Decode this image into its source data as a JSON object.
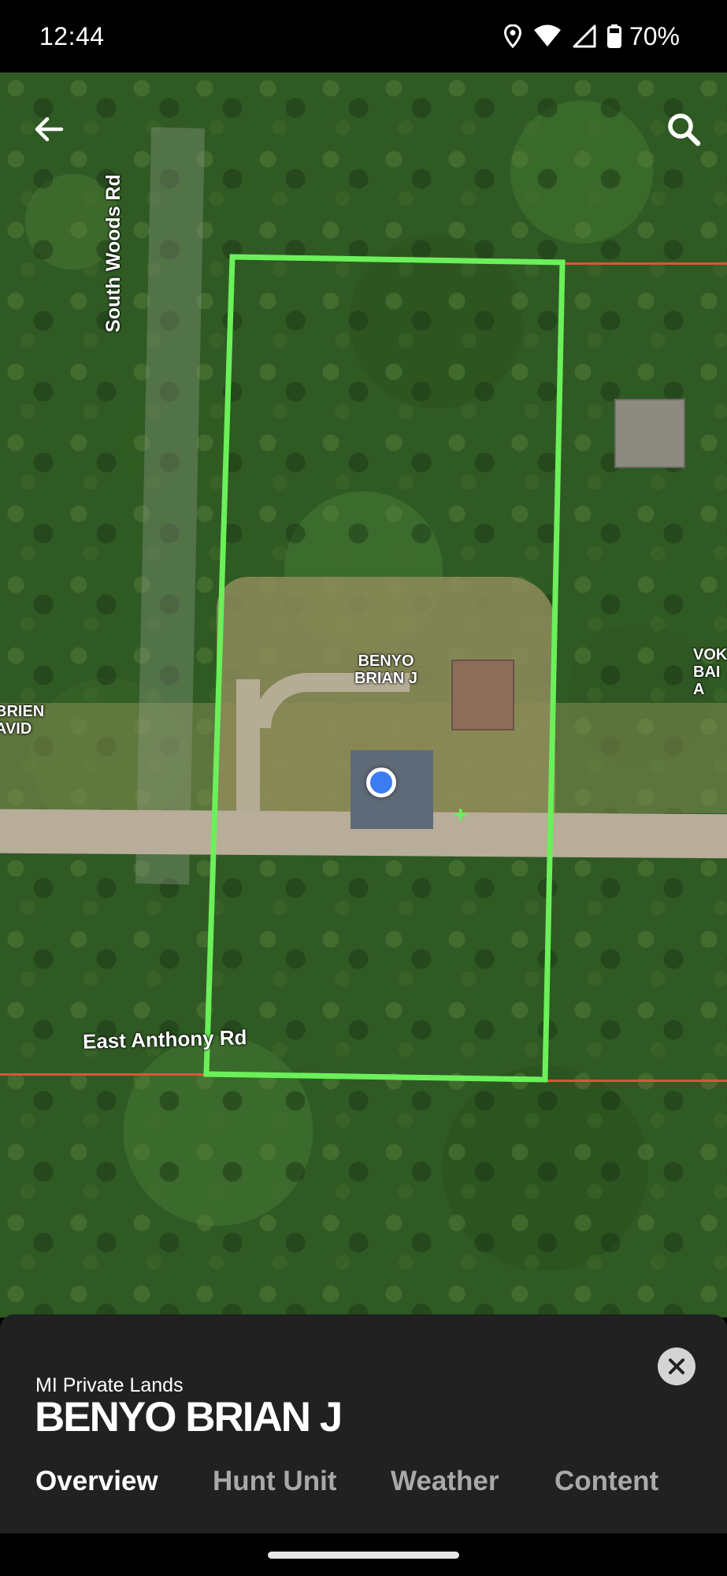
{
  "status_bar": {
    "time": "12:44",
    "battery": "70%",
    "icons": [
      "location-icon",
      "wifi-icon",
      "cell-signal-icon",
      "battery-icon"
    ]
  },
  "map": {
    "roads": {
      "north_south": "South Woods Rd",
      "east_west": "East Anthony Rd"
    },
    "owner_labels": {
      "parcel": "BENYO\nBRIAN J",
      "left_partial": "BRIEN\nAVID",
      "right_partial": "VOK\nBAI\nA"
    },
    "parcel_outline_color": "#6bf05a",
    "property_line_color": "#d9553a",
    "location_dot_color": "#3b7cf0"
  },
  "sheet": {
    "subtitle": "MI Private Lands",
    "title": "BENYO BRIAN J",
    "tabs": [
      {
        "label": "Overview",
        "active": true
      },
      {
        "label": "Hunt Unit",
        "active": false
      },
      {
        "label": "Weather",
        "active": false
      },
      {
        "label": "Content",
        "active": false
      }
    ]
  }
}
